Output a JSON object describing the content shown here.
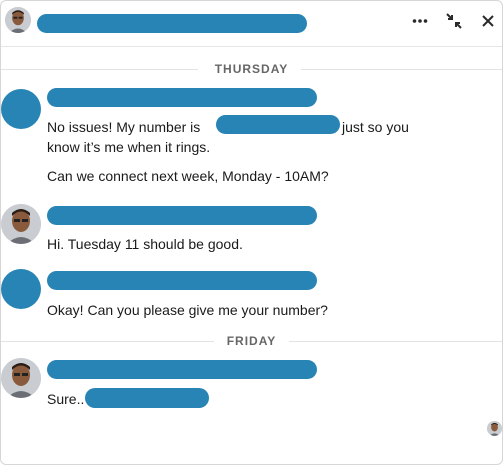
{
  "window": {
    "more_icon": "more-icon",
    "minimize_icon": "minimize-icon",
    "close_icon": "close-icon"
  },
  "dividers": {
    "thursday": "THURSDAY",
    "friday": "FRIDAY"
  },
  "messages": {
    "m1_part1": "No issues! My number is",
    "m1_part2": "just so you",
    "m1_line2": "know it’s me when it rings.",
    "m2": "Can we connect next week, Monday - 10AM?",
    "m3": "Hi. Tuesday 11 should be good.",
    "m4": "Okay! Can you please give me your number?",
    "m5": "Sure.."
  },
  "colors": {
    "redaction": "#2784b5",
    "divider_text": "#666666"
  }
}
